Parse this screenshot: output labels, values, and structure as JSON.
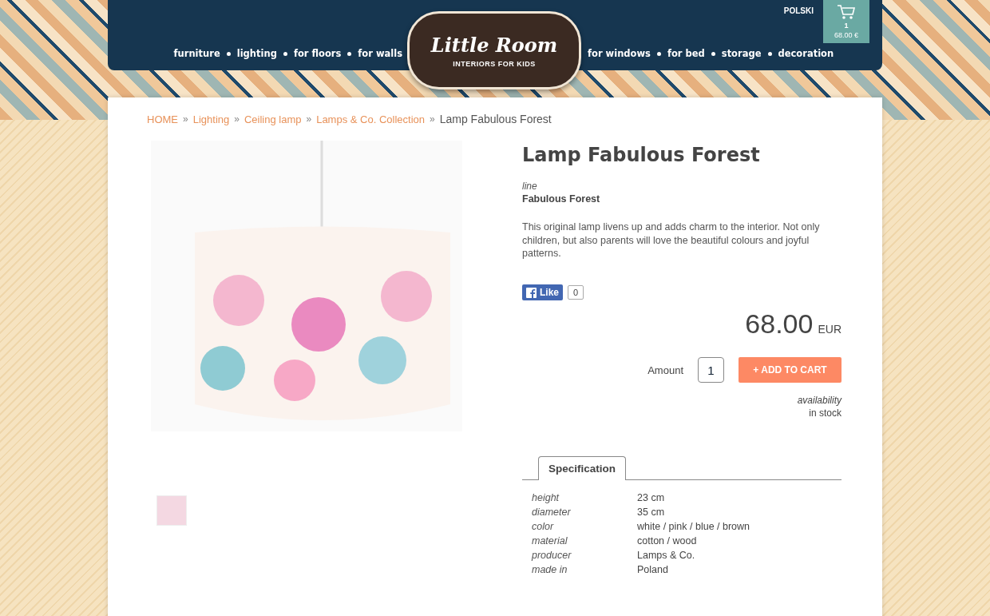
{
  "header": {
    "language": "POLSKI",
    "cart": {
      "count": "1",
      "total": "68.00 €"
    },
    "nav_left": [
      "furniture",
      "lighting",
      "for floors",
      "for walls"
    ],
    "logo": {
      "title": "Little Room",
      "subtitle": "INTERIORS FOR KIDS"
    },
    "nav_right": [
      "for windows",
      "for bed",
      "storage",
      "decoration"
    ]
  },
  "breadcrumb": {
    "separator": "»",
    "items": [
      {
        "label": "HOME",
        "current": false
      },
      {
        "label": "Lighting",
        "current": false
      },
      {
        "label": "Ceiling lamp",
        "current": false
      },
      {
        "label": "Lamps & Co. Collection",
        "current": false
      },
      {
        "label": "Lamp Fabulous Forest",
        "current": true
      }
    ]
  },
  "product": {
    "title": "Lamp Fabulous Forest",
    "line_label": "line",
    "line": "Fabulous Forest",
    "description": "This original lamp livens up and adds charm to the interior. Not only children, but also parents will love the beautiful colours and joyful patterns.",
    "like": {
      "label": "Like",
      "count": "0"
    },
    "price": "68.00",
    "currency": "EUR",
    "amount_label": "Amount",
    "amount": "1",
    "add_to_cart": {
      "icon": "+",
      "label": "ADD TO CART"
    },
    "availability_label": "availability",
    "availability": "in stock"
  },
  "tabs": [
    {
      "label": "Specification",
      "selected": true
    }
  ],
  "specs": [
    {
      "name": "height",
      "value": "23 cm"
    },
    {
      "name": "diameter",
      "value": "35 cm"
    },
    {
      "name": "color",
      "value": "white / pink / blue / brown"
    },
    {
      "name": "material",
      "value": "cotton / wood"
    },
    {
      "name": "producer",
      "value": "Lamps & Co."
    },
    {
      "name": "made in",
      "value": "Poland"
    }
  ]
}
